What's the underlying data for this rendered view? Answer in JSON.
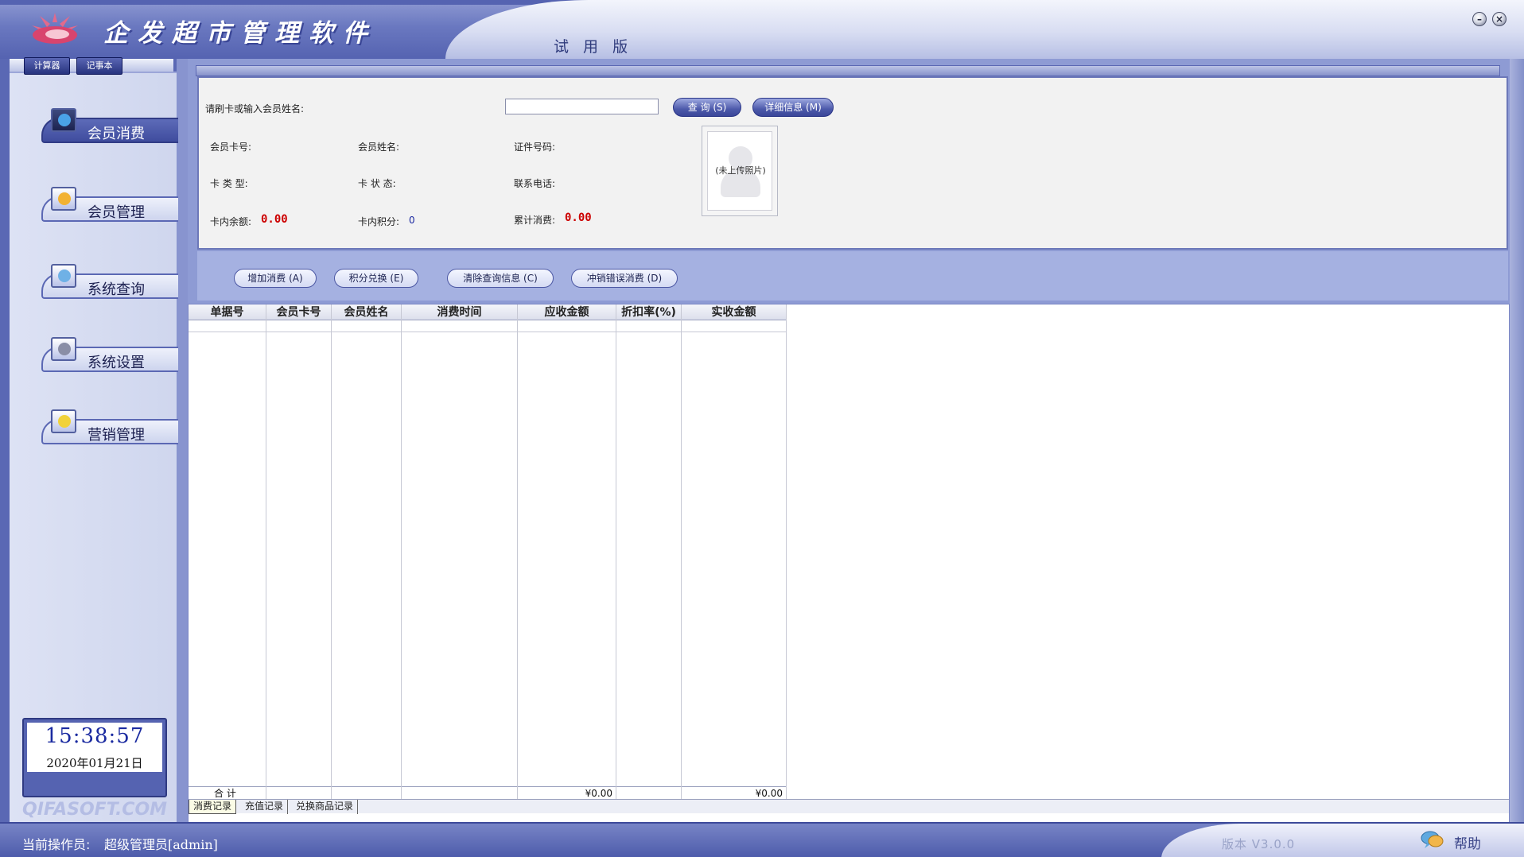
{
  "window": {
    "title": "企发超市管理软件",
    "edition": "试 用 版",
    "minimize_label": "–",
    "close_label": "×"
  },
  "sidebar": {
    "items": [
      {
        "label": "会员消费",
        "icon": "member-consume-icon",
        "active": true
      },
      {
        "label": "会员管理",
        "icon": "member-manage-icon",
        "active": false
      },
      {
        "label": "系统查询",
        "icon": "system-query-icon",
        "active": false
      },
      {
        "label": "系统设置",
        "icon": "system-settings-icon",
        "active": false
      },
      {
        "label": "营销管理",
        "icon": "marketing-icon",
        "active": false
      }
    ],
    "clock": {
      "time": "15:38:57",
      "date": "2020年01月21日",
      "calculator_label": "计算器",
      "notepad_label": "记事本"
    },
    "watermark": "QIFASOFT.COM"
  },
  "info_panel": {
    "search_label": "请刷卡或输入会员姓名:",
    "search_value": "",
    "query_button": "查 询 (S)",
    "detail_button": "详细信息 (M)",
    "card_no_label": "会员卡号:",
    "name_label": "会员姓名:",
    "id_no_label": "证件号码:",
    "card_type_label": "卡 类 型:",
    "card_status_label": "卡 状 态:",
    "phone_label": "联系电话:",
    "balance_label": "卡内余额:",
    "balance_value": "0.00",
    "points_label": "卡内积分:",
    "points_value": "0",
    "total_spent_label": "累计消费:",
    "total_spent_value": "0.00",
    "photo_placeholder": "(未上传照片)"
  },
  "actions": {
    "add_consume": "增加消费 (A)",
    "points_exchange": "积分兑换 (E)",
    "clear_query": "清除查询信息 (C)",
    "reverse_consume": "冲销错误消费 (D)"
  },
  "grid": {
    "columns": [
      "单据号",
      "会员卡号",
      "会员姓名",
      "消费时间",
      "应收金额",
      "折扣率(%)",
      "实收金额"
    ],
    "footer": {
      "total_label": "合 计",
      "receivable_total": "¥0.00",
      "received_total": "¥0.00"
    },
    "tabs": [
      "消费记录",
      "充值记录",
      "兑换商品记录"
    ],
    "active_tab": 0
  },
  "statusbar": {
    "operator_label": "当前操作员:",
    "operator_value": "超级管理员[admin]",
    "version": "版本 V3.0.0",
    "help_label": "帮助"
  },
  "colors": {
    "accent": "#5563b1",
    "panel": "#f2f2f2",
    "money_red": "#cc0000"
  }
}
